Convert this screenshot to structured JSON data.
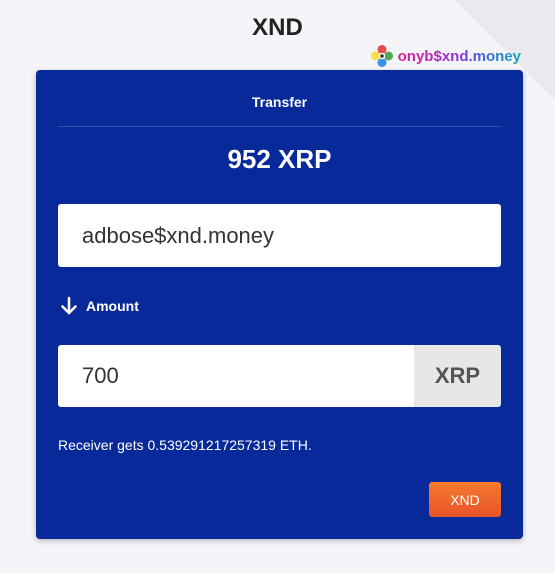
{
  "app": {
    "title": "XND",
    "brand_text": "onyb$xnd.money",
    "brand_icon": "colorful-flower-logo"
  },
  "transfer": {
    "header": "Transfer",
    "balance": "952 XRP",
    "recipient_value": "adbose$xnd.money",
    "amount_label": "Amount",
    "amount_icon": "arrow-down-icon",
    "amount_value": "700",
    "currency": "XRP",
    "receiver_note": "Receiver gets 0.539291217257319 ETH.",
    "submit_label": "XND"
  },
  "colors": {
    "card_background": "#08299a",
    "page_background": "#f5f5f9",
    "button_start": "#f57a2e",
    "button_end": "#e8542a",
    "currency_addon": "#e7e7e7"
  }
}
